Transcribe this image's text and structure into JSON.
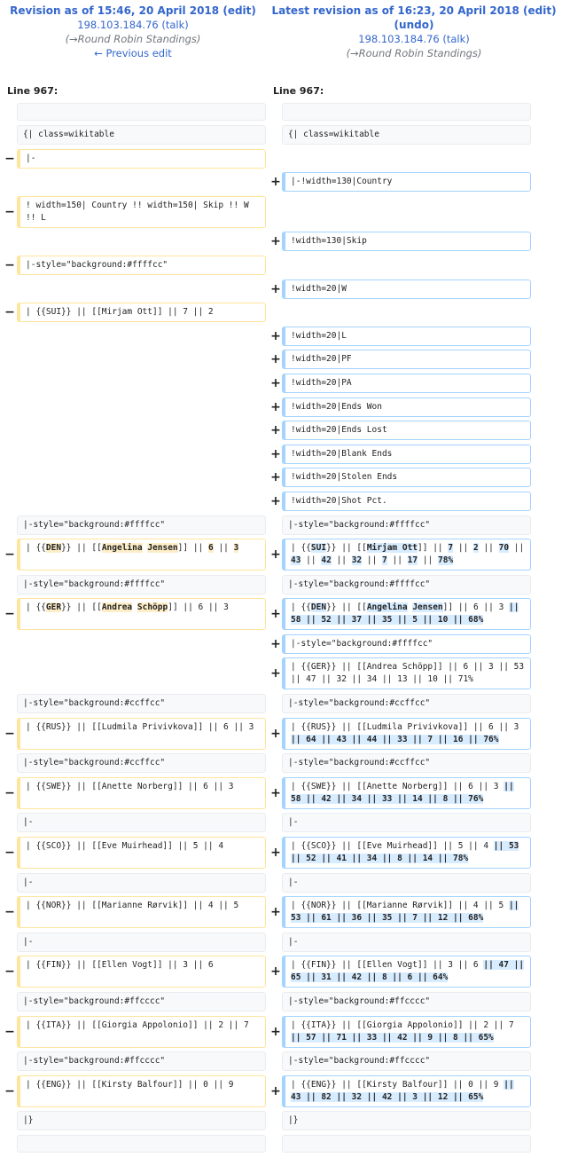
{
  "header": {
    "left": {
      "title_prefix": "Revision as of 15:46, 20 April 2018",
      "edit": "(edit)",
      "user": "198.103.184.76",
      "talk": "(talk)",
      "summary": "(→Round Robin Standings)",
      "prev": "← Previous edit"
    },
    "right": {
      "title_prefix": "Latest revision as of 16:23, 20 April 2018",
      "edit": "(edit)",
      "undo": "(undo)",
      "user": "198.103.184.76",
      "talk": "(talk)",
      "summary": "(→Round Robin Standings)"
    },
    "line_left": "Line 967:",
    "line_right": "Line 967:"
  },
  "markers": {
    "minus": "−",
    "plus": "+"
  },
  "rows": [
    {
      "l": {
        "t": "ctx",
        "s": [
          ""
        ]
      },
      "r": {
        "t": "ctx",
        "s": [
          ""
        ]
      }
    },
    {
      "l": {
        "t": "ctx",
        "s": [
          "{| class=wikitable"
        ]
      },
      "r": {
        "t": "ctx",
        "s": [
          "{| class=wikitable"
        ]
      }
    },
    {
      "l": {
        "t": "del",
        "s": [
          "|-"
        ]
      },
      "r": null
    },
    {
      "l": null,
      "r": {
        "t": "add",
        "s": [
          "|-!width=130|Country"
        ]
      }
    },
    {
      "l": {
        "t": "del",
        "s": [
          "! width=150| Country !! width=150| Skip !! W !! L"
        ]
      },
      "r": null
    },
    {
      "l": null,
      "r": {
        "t": "add",
        "s": [
          "!width=130|Skip"
        ]
      }
    },
    {
      "l": {
        "t": "del",
        "s": [
          "|-style=\"background:#ffffcc\""
        ]
      },
      "r": null
    },
    {
      "l": null,
      "r": {
        "t": "add",
        "s": [
          "!width=20|W"
        ]
      }
    },
    {
      "l": {
        "t": "del",
        "s": [
          "| {{SUI}} || [[Mirjam Ott]] || 7 || 2"
        ]
      },
      "r": null
    },
    {
      "l": null,
      "r": {
        "t": "add",
        "s": [
          "!width=20|L"
        ]
      }
    },
    {
      "l": null,
      "r": {
        "t": "add",
        "s": [
          "!width=20|PF"
        ]
      }
    },
    {
      "l": null,
      "r": {
        "t": "add",
        "s": [
          "!width=20|PA"
        ]
      }
    },
    {
      "l": null,
      "r": {
        "t": "add",
        "s": [
          "!width=20|Ends Won"
        ]
      }
    },
    {
      "l": null,
      "r": {
        "t": "add",
        "s": [
          "!width=20|Ends Lost"
        ]
      }
    },
    {
      "l": null,
      "r": {
        "t": "add",
        "s": [
          "!width=20|Blank Ends"
        ]
      }
    },
    {
      "l": null,
      "r": {
        "t": "add",
        "s": [
          "!width=20|Stolen Ends"
        ]
      }
    },
    {
      "l": null,
      "r": {
        "t": "add",
        "s": [
          "!width=20|Shot Pct."
        ]
      }
    },
    {
      "l": {
        "t": "ctx",
        "s": [
          "|-style=\"background:#ffffcc\""
        ]
      },
      "r": {
        "t": "ctx",
        "s": [
          "|-style=\"background:#ffffcc\""
        ]
      }
    },
    {
      "l": {
        "t": "del",
        "s": [
          "| {{",
          "*DEN",
          "}} || [[",
          "*Angelina",
          " ",
          "*Jensen",
          "]] || ",
          "*6",
          " || ",
          "*3"
        ]
      },
      "r": {
        "t": "add",
        "s": [
          "| {{",
          "*SUI",
          "}} || [[",
          "*Mirjam Ott",
          "]] || ",
          "*7",
          " || ",
          "*2",
          " || ",
          "*70",
          " || ",
          "*43",
          " || ",
          "*42",
          " || ",
          "*32",
          " || ",
          "*7",
          " || ",
          "*17",
          " || ",
          "*78%"
        ]
      }
    },
    {
      "l": {
        "t": "ctx",
        "s": [
          "|-style=\"background:#ffffcc\""
        ]
      },
      "r": {
        "t": "ctx",
        "s": [
          "|-style=\"background:#ffffcc\""
        ]
      }
    },
    {
      "l": {
        "t": "del",
        "s": [
          "| {{",
          "*GER",
          "}} || [[",
          "*Andrea",
          " ",
          "*Schöpp",
          "]] || 6 || 3"
        ]
      },
      "r": {
        "t": "add",
        "s": [
          "| {{",
          "*DEN",
          "}} || [[",
          "*Angelina",
          " ",
          "*Jensen",
          "]] || 6 || 3 ",
          "*|| 58 || 52 || 37 || 35 || 5 || 10 || 68%"
        ]
      }
    },
    {
      "l": null,
      "r": {
        "t": "add",
        "s": [
          "|-style=\"background:#ffffcc\""
        ]
      }
    },
    {
      "l": null,
      "r": {
        "t": "add",
        "s": [
          "| {{GER}} || [[Andrea Schöpp]] || 6 || 3 || 53 || 47 || 32 || 34 || 13 || 10 || 71%"
        ]
      }
    },
    {
      "l": {
        "t": "ctx",
        "s": [
          "|-style=\"background:#ccffcc\""
        ]
      },
      "r": {
        "t": "ctx",
        "s": [
          "|-style=\"background:#ccffcc\""
        ]
      }
    },
    {
      "l": {
        "t": "del",
        "s": [
          "| {{RUS}} || [[Ludmila Privivkova]] || 6 || 3"
        ]
      },
      "r": {
        "t": "add",
        "s": [
          "| {{RUS}} || [[Ludmila Privivkova]] || 6 || 3 ",
          "*|| 64 || 43 || 44 || 33 || 7 || 16 || 76%"
        ]
      }
    },
    {
      "l": {
        "t": "ctx",
        "s": [
          "|-style=\"background:#ccffcc\""
        ]
      },
      "r": {
        "t": "ctx",
        "s": [
          "|-style=\"background:#ccffcc\""
        ]
      }
    },
    {
      "l": {
        "t": "del",
        "s": [
          "| {{SWE}} || [[Anette Norberg]] || 6 || 3"
        ]
      },
      "r": {
        "t": "add",
        "s": [
          "| {{SWE}} || [[Anette Norberg]] || 6 || 3 ",
          "*|| 58 || 42 || 34 || 33 || 14 || 8 || 76%"
        ]
      }
    },
    {
      "l": {
        "t": "ctx",
        "s": [
          "|-"
        ]
      },
      "r": {
        "t": "ctx",
        "s": [
          "|-"
        ]
      }
    },
    {
      "l": {
        "t": "del",
        "s": [
          "| {{SCO}} || [[Eve Muirhead]] || 5 || 4"
        ]
      },
      "r": {
        "t": "add",
        "s": [
          "| {{SCO}} || [[Eve Muirhead]] || 5 || 4 ",
          "*|| 53 || 52 || 41 || 34 || 8 || 14 || 78%"
        ]
      }
    },
    {
      "l": {
        "t": "ctx",
        "s": [
          "|-"
        ]
      },
      "r": {
        "t": "ctx",
        "s": [
          "|-"
        ]
      }
    },
    {
      "l": {
        "t": "del",
        "s": [
          "| {{NOR}} || [[Marianne Rørvik]] || 4 || 5"
        ]
      },
      "r": {
        "t": "add",
        "s": [
          "| {{NOR}} || [[Marianne Rørvik]] || 4 || 5 ",
          "*|| 53 || 61 || 36 || 35 || 7 || 12 || 68%"
        ]
      }
    },
    {
      "l": {
        "t": "ctx",
        "s": [
          "|-"
        ]
      },
      "r": {
        "t": "ctx",
        "s": [
          "|-"
        ]
      }
    },
    {
      "l": {
        "t": "del",
        "s": [
          "| {{FIN}} || [[Ellen Vogt]] || 3 || 6"
        ]
      },
      "r": {
        "t": "add",
        "s": [
          "| {{FIN}} || [[Ellen Vogt]] || 3 || 6 ",
          "*|| 47 || 65 || 31 || 42 || 8 || 6 || 64%"
        ]
      }
    },
    {
      "l": {
        "t": "ctx",
        "s": [
          "|-style=\"background:#ffcccc\""
        ]
      },
      "r": {
        "t": "ctx",
        "s": [
          "|-style=\"background:#ffcccc\""
        ]
      }
    },
    {
      "l": {
        "t": "del",
        "s": [
          "| {{ITA}} || [[Giorgia Appolonio]] || 2 || 7"
        ]
      },
      "r": {
        "t": "add",
        "s": [
          "| {{ITA}} || [[Giorgia Appolonio]] || 2 || 7 ",
          "*|| 57 || 71 || 33 || 42 || 9 || 8 || 65%"
        ]
      }
    },
    {
      "l": {
        "t": "ctx",
        "s": [
          "|-style=\"background:#ffcccc\""
        ]
      },
      "r": {
        "t": "ctx",
        "s": [
          "|-style=\"background:#ffcccc\""
        ]
      }
    },
    {
      "l": {
        "t": "del",
        "s": [
          "| {{ENG}} || [[Kirsty Balfour]] || 0 || 9"
        ]
      },
      "r": {
        "t": "add",
        "s": [
          "| {{ENG}} || [[Kirsty Balfour]] || 0 || 9 ",
          "*|| 43 || 82 || 32 || 42 || 3 || 12 || 65%"
        ]
      }
    },
    {
      "l": {
        "t": "ctx",
        "s": [
          "|}"
        ]
      },
      "r": {
        "t": "ctx",
        "s": [
          "|}"
        ]
      }
    },
    {
      "l": {
        "t": "ctx",
        "s": [
          ""
        ]
      },
      "r": {
        "t": "ctx",
        "s": [
          ""
        ]
      }
    }
  ]
}
